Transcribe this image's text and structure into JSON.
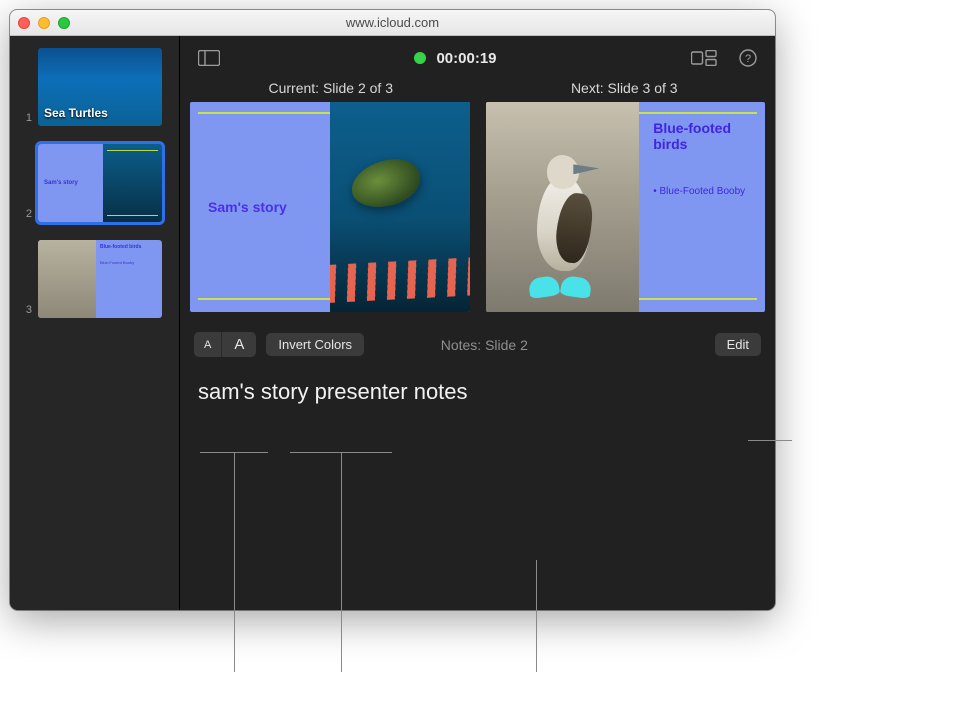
{
  "window": {
    "title": "www.icloud.com"
  },
  "timer": "00:00:19",
  "sidebar": {
    "slides": [
      {
        "num": "1",
        "title": "Sea Turtles"
      },
      {
        "num": "2",
        "title": "Sam's story"
      },
      {
        "num": "3",
        "t1": "Blue-footed birds",
        "t2": "Blue-Footed Booby"
      }
    ]
  },
  "preview": {
    "current_label": "Current: Slide 2 of 3",
    "next_label": "Next: Slide 3 of 3",
    "current": {
      "heading": "Sam's story"
    },
    "next": {
      "heading": "Blue-footed birds",
      "bullet": "Blue-Footed Booby"
    }
  },
  "notes": {
    "font_small": "A",
    "font_large": "A",
    "invert_label": "Invert Colors",
    "label": "Notes: Slide 2",
    "edit_label": "Edit",
    "text": "sam's story presenter notes"
  }
}
